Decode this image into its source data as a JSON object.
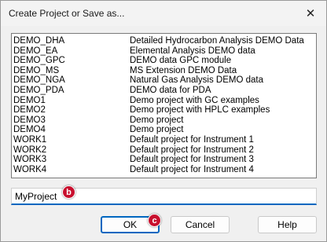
{
  "window": {
    "title": "Create Project or Save as...",
    "close_glyph": "✕"
  },
  "projects": [
    {
      "name": "DEMO_DHA",
      "description": "Detailed Hydrocarbon Analysis DEMO Data"
    },
    {
      "name": "DEMO_EA",
      "description": "Elemental Analysis DEMO data"
    },
    {
      "name": "DEMO_GPC",
      "description": "DEMO data GPC module"
    },
    {
      "name": "DEMO_MS",
      "description": "MS Extension DEMO Data"
    },
    {
      "name": "DEMO_NGA",
      "description": "Natural Gas Analysis DEMO data"
    },
    {
      "name": "DEMO_PDA",
      "description": "DEMO data for PDA"
    },
    {
      "name": "DEMO1",
      "description": "Demo project with GC examples"
    },
    {
      "name": "DEMO2",
      "description": "Demo project with HPLC examples"
    },
    {
      "name": "DEMO3",
      "description": "Demo project"
    },
    {
      "name": "DEMO4",
      "description": "Demo project"
    },
    {
      "name": "WORK1",
      "description": "Default project for Instrument 1"
    },
    {
      "name": "WORK2",
      "description": "Default project for Instrument 2"
    },
    {
      "name": "WORK3",
      "description": "Default project for Instrument 3"
    },
    {
      "name": "WORK4",
      "description": "Default project for Instrument 4"
    }
  ],
  "name_field": {
    "value": "MyProject"
  },
  "buttons": {
    "ok": "OK",
    "cancel": "Cancel",
    "help": "Help"
  },
  "callouts": {
    "b": "b",
    "c": "c"
  },
  "colors": {
    "accent": "#0067c0",
    "callout": "#c8102e"
  }
}
